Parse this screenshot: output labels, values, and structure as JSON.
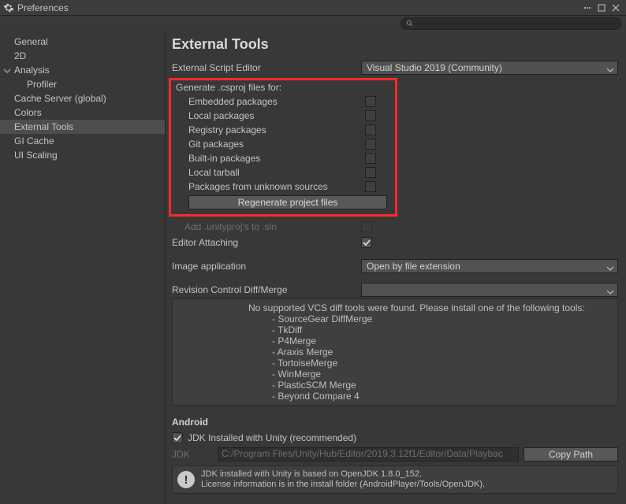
{
  "window": {
    "title": "Preferences"
  },
  "search": {
    "placeholder": ""
  },
  "sidebar": {
    "items": [
      {
        "label": "General"
      },
      {
        "label": "2D"
      },
      {
        "label": "Analysis"
      },
      {
        "label": "Profiler"
      },
      {
        "label": "Cache Server (global)"
      },
      {
        "label": "Colors"
      },
      {
        "label": "External Tools"
      },
      {
        "label": "GI Cache"
      },
      {
        "label": "UI Scaling"
      }
    ]
  },
  "content": {
    "heading": "External Tools",
    "script_editor_label": "External Script Editor",
    "script_editor_value": "Visual Studio 2019 (Community)",
    "generate_header": "Generate .csproj files for:",
    "csproj": [
      {
        "label": "Embedded packages"
      },
      {
        "label": "Local packages"
      },
      {
        "label": "Registry packages"
      },
      {
        "label": "Git packages"
      },
      {
        "label": "Built-in packages"
      },
      {
        "label": "Local tarball"
      },
      {
        "label": "Packages from unknown sources"
      }
    ],
    "regenerate_label": "Regenerate project files",
    "add_unityproj_label": "Add .unityproj's to .sln",
    "editor_attaching_label": "Editor Attaching",
    "image_app_label": "Image application",
    "image_app_value": "Open by file extension",
    "revision_label": "Revision Control Diff/Merge",
    "vcs_msg": "No supported VCS diff tools were found. Please install one of the following tools:",
    "vcs_tools": [
      "- SourceGear DiffMerge",
      "- TkDiff",
      "- P4Merge",
      "- Araxis Merge",
      "- TortoiseMerge",
      "- WinMerge",
      "- PlasticSCM Merge",
      "- Beyond Compare 4"
    ],
    "android_heading": "Android",
    "jdk_installed_label": "JDK Installed with Unity (recommended)",
    "jdk_label": "JDK",
    "jdk_path": "C:/Program Files/Unity/Hub/Editor/2019.3.12f1/Editor/Data/Playbac",
    "copy_path_label": "Copy Path",
    "jdk_info_line1": "JDK installed with Unity is based on OpenJDK 1.8.0_152.",
    "jdk_info_line2": "License information is in the install folder (AndroidPlayer/Tools/OpenJDK)."
  }
}
